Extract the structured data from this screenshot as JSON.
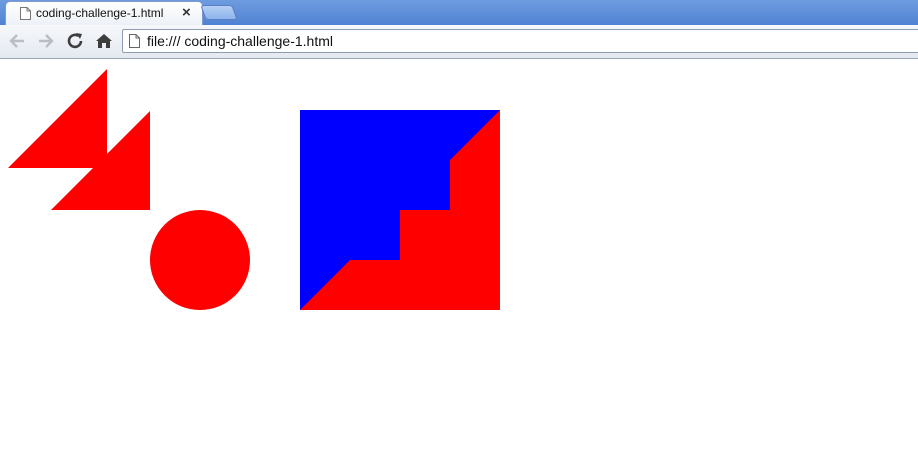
{
  "browser": {
    "tab": {
      "title": "coding-challenge-1.html",
      "close_glyph": "×",
      "icon": "page-icon"
    },
    "toolbar": {
      "back_icon": "back-arrow-icon",
      "forward_icon": "forward-arrow-icon",
      "reload_icon": "reload-icon",
      "home_icon": "home-icon",
      "address_icon": "page-icon",
      "address_url": "file:/// coding-challenge-1.html"
    }
  },
  "page": {
    "shapes": [
      {
        "kind": "triangle",
        "color": "#ff0000"
      },
      {
        "kind": "triangle",
        "color": "#ff0000"
      },
      {
        "kind": "circle",
        "color": "#ff0000"
      },
      {
        "kind": "square-split-staircase",
        "colors": [
          "#0000ff",
          "#ff0000"
        ]
      }
    ]
  },
  "colors": {
    "accent_red": "#ff0000",
    "accent_blue": "#0000ff",
    "tabstrip_blue": "#4f82d3"
  }
}
